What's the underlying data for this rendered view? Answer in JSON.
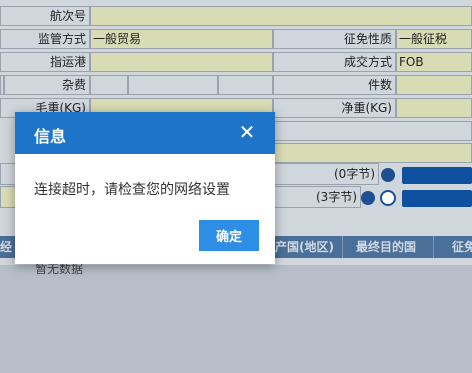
{
  "form": {
    "voyage_no_label": "航次号",
    "supervision_mode_label": "监管方式",
    "supervision_mode_value": "一般贸易",
    "tax_nature_label": "征免性质",
    "tax_nature_value": "一般征税",
    "dest_port_label": "指运港",
    "transaction_mode_label": "成交方式",
    "transaction_mode_value": "FOB",
    "misc_fee_label": "杂费",
    "pieces_label": "件数",
    "gross_weight_label": "毛重(KG)",
    "net_weight_label": "净重(KG)",
    "byte_count_1": "(0字节)",
    "byte_count_2": "(3字节)"
  },
  "table": {
    "headers": [
      "经",
      "产国(地区)",
      "最终目的国",
      "征免"
    ],
    "empty_text": "暂无数据"
  },
  "dialog": {
    "title": "信息",
    "close_symbol": "✕",
    "message": "连接超时，请检查您的网络设置",
    "ok_label": "确定"
  },
  "colors": {
    "dialog_header": "#1e74c9",
    "ok_button": "#2e8ee6",
    "input_bg": "#d8dcb4",
    "label_bg": "#cfd6dc"
  }
}
